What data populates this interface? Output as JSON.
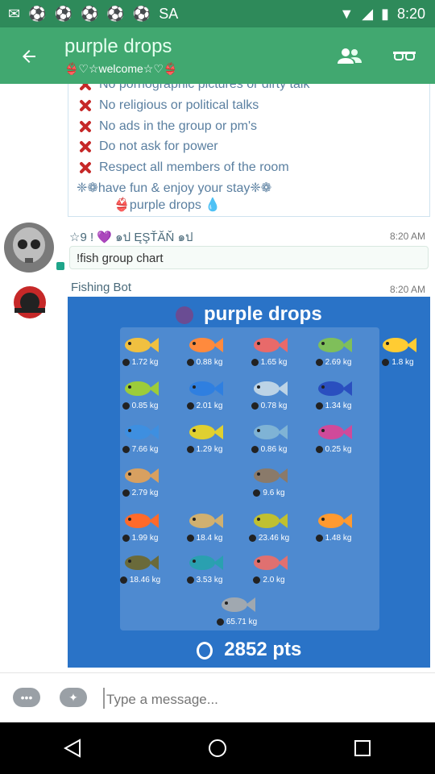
{
  "status_bar": {
    "time": "8:20",
    "notifications": [
      "mail-icon",
      "soccer-ball-icon",
      "soccer-ball-icon",
      "soccer-ball-icon",
      "soccer-ball-icon",
      "soccer-ball-icon"
    ],
    "carrier": "SA"
  },
  "header": {
    "title": "purple drops",
    "subtitle": "👙♡☆welcome☆♡👙"
  },
  "rules": {
    "partial": "No pornographic pictures or dirty talk",
    "items": [
      "No religious or political talks",
      "No ads in the group or pm's",
      "Do not ask for power",
      "Respect all members of the room"
    ],
    "footer1": "❈❁have fun & enjoy your stay❈❁",
    "footer2": "👙purple drops 💧"
  },
  "message1": {
    "sender": "☆9 ! 💜 ๑ป ĘŞŤĂŇ ๑ป",
    "time": "8:20 AM",
    "text": "!fish group chart"
  },
  "message2": {
    "sender": "Fishing Bot",
    "time": "8:20 AM",
    "card_title": "purple drops",
    "points": "2852 pts",
    "fish": [
      {
        "w": "1.72 kg"
      },
      {
        "w": "0.88 kg"
      },
      {
        "w": "1.65 kg"
      },
      {
        "w": "2.69 kg"
      },
      {
        "w": "1.8 kg"
      },
      {
        "w": "0.85 kg"
      },
      {
        "w": "2.01 kg"
      },
      {
        "w": "0.78 kg"
      },
      {
        "w": "1.34 kg"
      },
      {
        "w": "7.66 kg"
      },
      {
        "w": "1.29 kg"
      },
      {
        "w": "0.86 kg"
      },
      {
        "w": "0.25 kg"
      },
      {
        "w": "2.79 kg"
      },
      {
        "w": "9.6 kg"
      },
      {
        "w": "1.99 kg"
      },
      {
        "w": "18.4 kg"
      },
      {
        "w": "23.46 kg"
      },
      {
        "w": "1.48 kg"
      },
      {
        "w": "18.46 kg"
      },
      {
        "w": "3.53 kg"
      },
      {
        "w": "2.0 kg"
      },
      {
        "w": "65.71 kg"
      }
    ]
  },
  "composer": {
    "placeholder": "Type a message..."
  },
  "colors": {
    "appbar": "#41a870",
    "statusbar": "#2e8a5a",
    "card": "#2a73c7",
    "rule_x": "#c62828"
  }
}
